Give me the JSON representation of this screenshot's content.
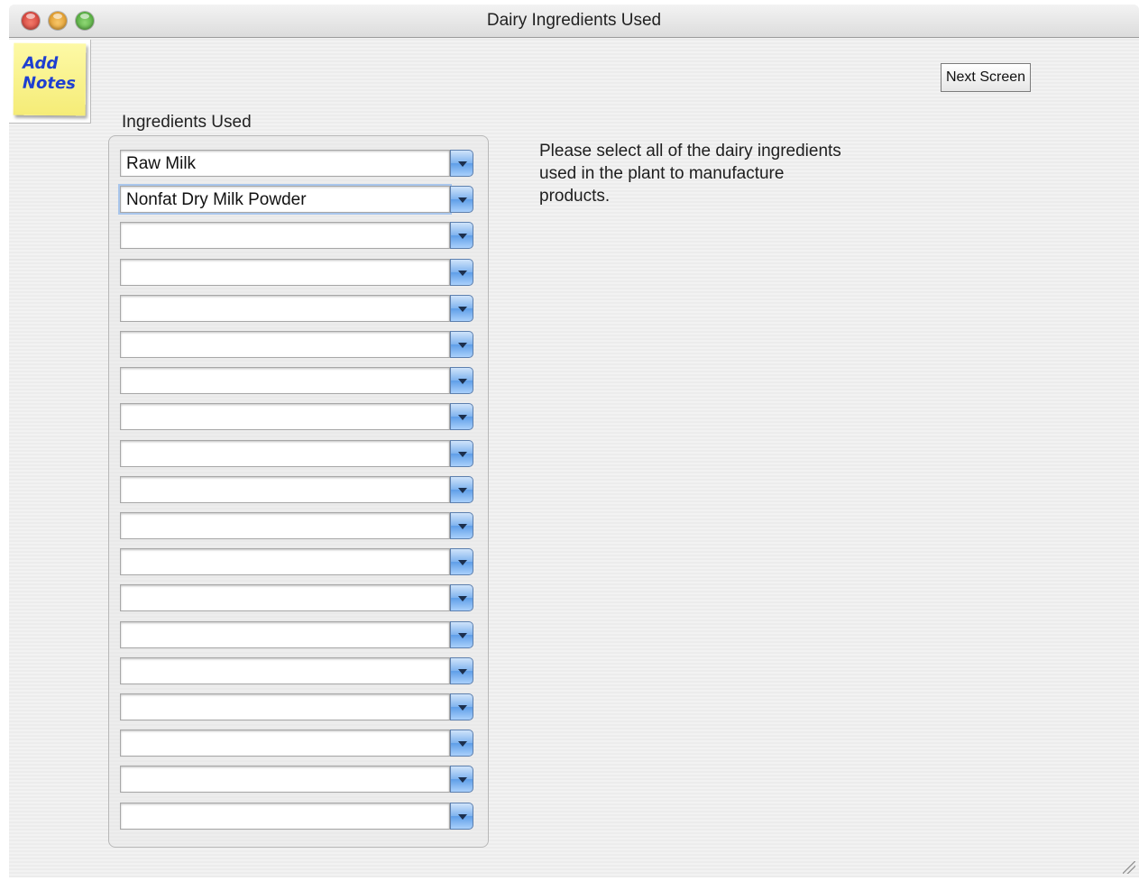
{
  "window": {
    "title": "Dairy Ingredients Used"
  },
  "sticky_note": {
    "label": "Add\nNotes"
  },
  "toolbar": {
    "next_label": "Next Screen"
  },
  "ingredients": {
    "group_label": "Ingredients Used",
    "rows": [
      "Raw Milk",
      "Nonfat Dry Milk Powder",
      "",
      "",
      "",
      "",
      "",
      "",
      "",
      "",
      "",
      "",
      "",
      "",
      "",
      "",
      "",
      "",
      ""
    ]
  },
  "instruction": "Please select all of the dairy ingredients used in the plant to manufacture products.",
  "colors": {
    "sticky_yellow": "#f5ec77",
    "sticky_ink": "#1f3fd1",
    "combo_blue": "#5e9ee8"
  }
}
